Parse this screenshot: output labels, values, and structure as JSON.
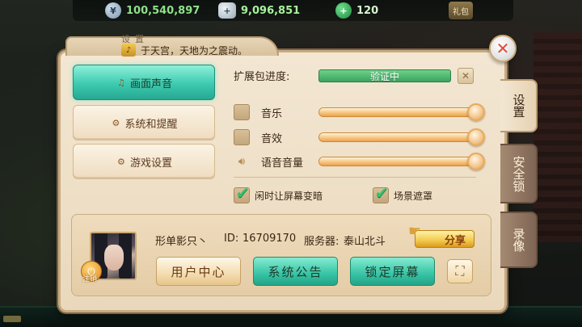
{
  "topbar": {
    "coins": "100,540,897",
    "silver": "9,096,851",
    "gems": "120",
    "gift_label": "礼包",
    "coin_icon": "coin-icon",
    "silver_icon": "silver-ingot-icon",
    "gem_icon": "jade-icon"
  },
  "dialog": {
    "title": "设置",
    "notice": "于天宫，天地为之震动。"
  },
  "categories": [
    {
      "label": "画面声音",
      "icon": "music-note-icon",
      "active": true
    },
    {
      "label": "系统和提醒",
      "icon": "gear-icon",
      "active": false
    },
    {
      "label": "游戏设置",
      "icon": "gear-icon",
      "active": false
    }
  ],
  "settings": {
    "extension_label": "扩展包进度:",
    "extension_status": "验证中",
    "extension_progress": 1.0,
    "volume": [
      {
        "label": "音乐",
        "level": 1.0
      },
      {
        "label": "音效",
        "level": 1.0
      },
      {
        "label": "语音音量",
        "level": 1.0
      }
    ],
    "idle_dim_label": "闲时让屏幕变暗",
    "idle_dim_checked": true,
    "scene_mask_label": "场景遮罩",
    "scene_mask_checked": true
  },
  "user": {
    "name": "形单影只丶",
    "id_label": "ID:",
    "id": "16709170",
    "server_label": "服务器:",
    "server": "泰山北斗",
    "logout_label": "注销",
    "share_label": "分享"
  },
  "actions": {
    "user_center": "用户中心",
    "system_notice": "系统公告",
    "lock_screen": "锁定屏幕"
  },
  "tabs": [
    {
      "label": "设置",
      "active": true
    },
    {
      "label": "安全锁",
      "active": false
    },
    {
      "label": "录像",
      "active": false
    }
  ],
  "colors": {
    "accent_teal": "#37c3a4",
    "panel_bg": "#f3e7d3",
    "resource_green": "#8fe08a"
  }
}
